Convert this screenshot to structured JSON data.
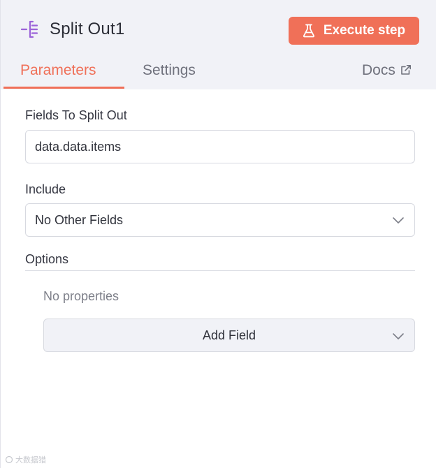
{
  "node": {
    "title": "Split Out1",
    "icon": "split-out-icon",
    "accent_color": "#9b63d8"
  },
  "toolbar": {
    "execute_label": "Execute step",
    "execute_color": "#f07058"
  },
  "tabs": {
    "parameters": "Parameters",
    "settings": "Settings",
    "docs": "Docs",
    "active": "parameters",
    "active_color": "#f07058"
  },
  "fields": {
    "fields_to_split_out": {
      "label": "Fields To Split Out",
      "value": "data.data.items"
    },
    "include": {
      "label": "Include",
      "value": "No Other Fields"
    },
    "options": {
      "label": "Options",
      "empty_text": "No properties",
      "add_field_label": "Add Field"
    }
  },
  "watermark": {
    "text": "大数据猎"
  }
}
